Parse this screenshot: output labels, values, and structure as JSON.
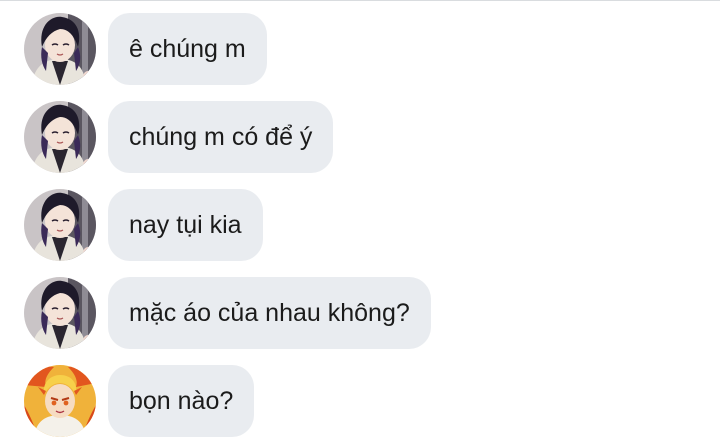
{
  "conversation": {
    "messages": [
      {
        "sender": "shinobu",
        "text": "ê chúng m"
      },
      {
        "sender": "shinobu",
        "text": "chúng m có để ý"
      },
      {
        "sender": "shinobu",
        "text": "nay tụi kia"
      },
      {
        "sender": "shinobu",
        "text": "mặc áo của nhau không?"
      },
      {
        "sender": "rengoku",
        "text": "bọn nào?"
      }
    ]
  },
  "colors": {
    "bubble_bg": "#e9ecf0",
    "text": "#1b1b1b",
    "top_border": "#d9dcdf"
  }
}
